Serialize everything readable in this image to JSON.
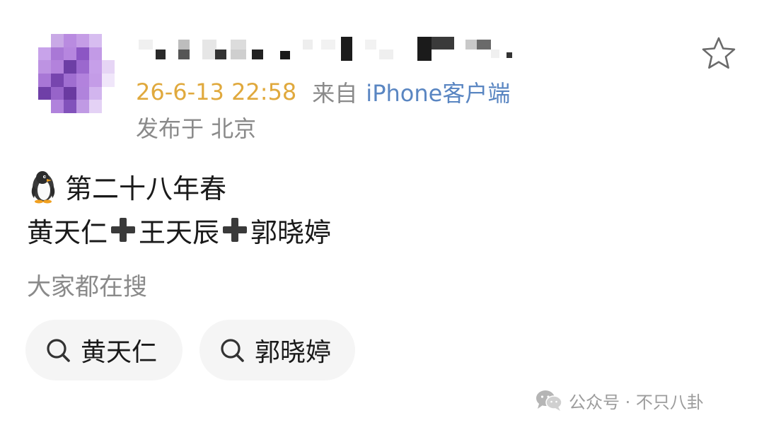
{
  "post": {
    "timestamp": "26-6-13 22:58",
    "source_prefix": "来自",
    "source": "iPhone客户端",
    "location": "发布于 北京",
    "line1_text": "第二十八年春",
    "line2_names": [
      "黄天仁",
      "王天辰",
      "郭晓婷"
    ]
  },
  "search_section": {
    "label": "大家都在搜",
    "chips": [
      "黄天仁",
      "郭晓婷"
    ]
  },
  "watermark": {
    "text": "公众号 · 不只八卦"
  },
  "icons": {
    "avatar": "pixelated-avatar",
    "favorite": "star-icon",
    "emoji": "penguin-emoji",
    "plus": "heavy-plus-icon",
    "search": "search-icon",
    "watermark": "wechat-icon"
  },
  "colors": {
    "timestamp": "#e0a93d",
    "source_link": "#5a86c2",
    "muted_text": "#8a8a8a",
    "chip_background": "#f5f5f5"
  }
}
